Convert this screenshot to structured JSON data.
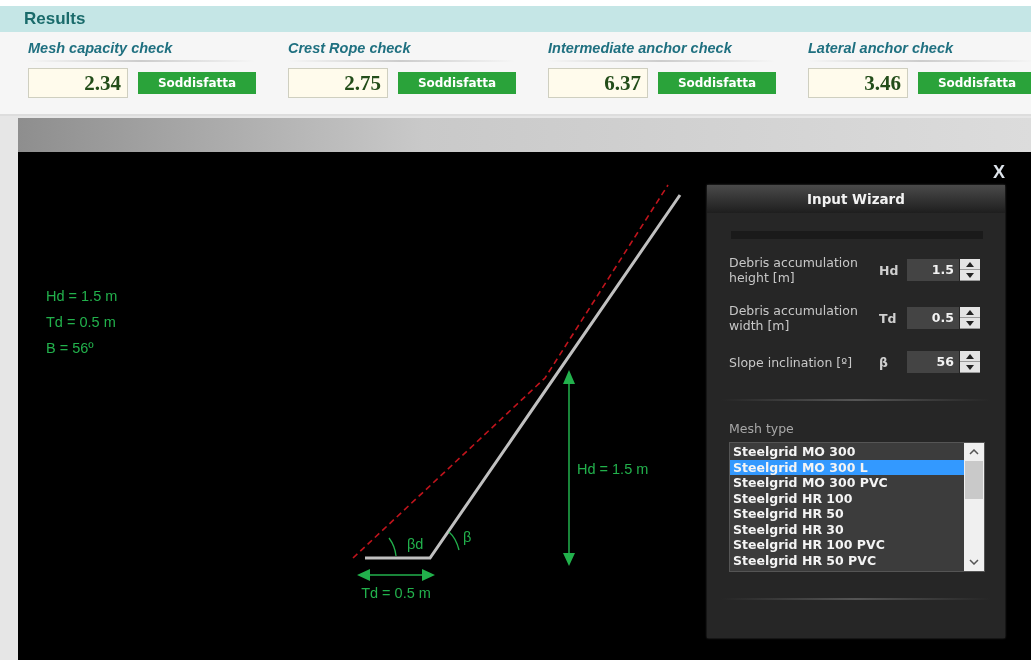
{
  "results": {
    "title": "Results",
    "checks": [
      {
        "label": "Mesh capacity check",
        "value": "2.34",
        "status": "Soddisfatta"
      },
      {
        "label": "Crest Rope check",
        "value": "2.75",
        "status": "Soddisfatta"
      },
      {
        "label": "Intermediate anchor check",
        "value": "6.37",
        "status": "Soddisfatta"
      },
      {
        "label": "Lateral anchor check",
        "value": "3.46",
        "status": "Soddisfatta"
      }
    ]
  },
  "diagram": {
    "summary": [
      "Hd = 1.5 m",
      "Td = 0.5 m",
      "B = 56º"
    ],
    "height_label": "Hd = 1.5 m",
    "width_label": "Td = 0.5 m",
    "angle_labels": [
      "βd",
      "β"
    ]
  },
  "close": "X",
  "wizard": {
    "title": "Input Wizard",
    "fields": [
      {
        "label": "Debris accumulation height [m]",
        "symbol": "Hd",
        "value": "1.5"
      },
      {
        "label": "Debris accumulation width [m]",
        "symbol": "Td",
        "value": "0.5"
      },
      {
        "label": "Slope inclination [º]",
        "symbol": "β",
        "value": "56"
      }
    ],
    "mesh_type": {
      "label": "Mesh type",
      "items": [
        {
          "label": "Steelgrid MO 300",
          "selected": false
        },
        {
          "label": "Steelgrid MO 300 L",
          "selected": true
        },
        {
          "label": "Steelgrid MO 300 PVC",
          "selected": false
        },
        {
          "label": "Steelgrid HR 100",
          "selected": false
        },
        {
          "label": "Steelgrid HR 50",
          "selected": false
        },
        {
          "label": "Steelgrid HR 30",
          "selected": false
        },
        {
          "label": "Steelgrid HR 100 PVC",
          "selected": false
        },
        {
          "label": "Steelgrid HR 50 PVC",
          "selected": false
        }
      ]
    }
  }
}
